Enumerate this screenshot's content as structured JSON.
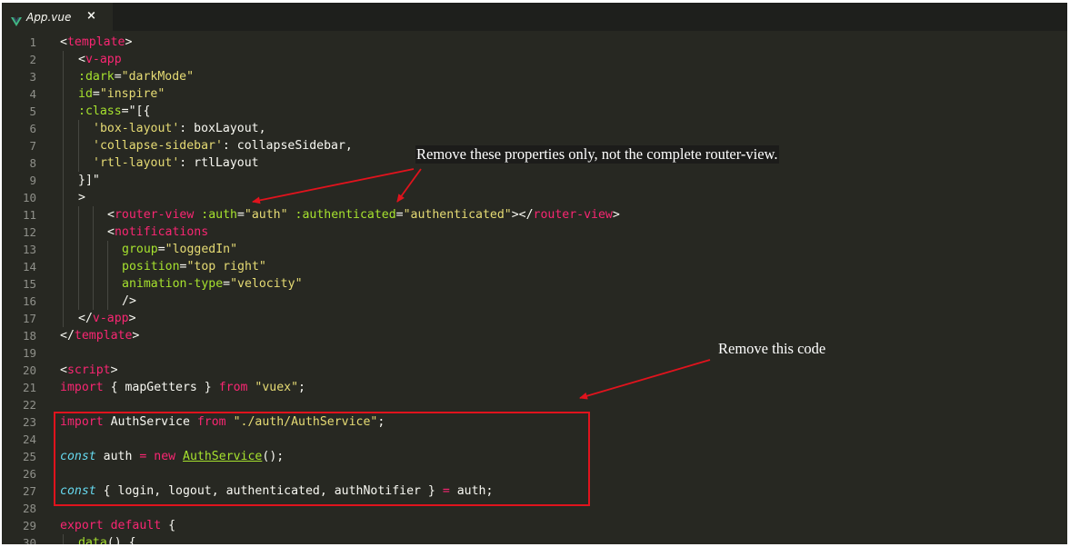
{
  "tab": {
    "title": "App.vue",
    "close": "×",
    "icon": "vue-icon"
  },
  "annotations": {
    "note1": "Remove these properties only, not the complete router-view.",
    "note2": "Remove this code",
    "arrow_color": "#e0131d"
  },
  "colors": {
    "background": "#272822",
    "tag": "#f92672",
    "attribute": "#a6e22e",
    "string": "#e6db74",
    "storage": "#66d9ef",
    "text": "#f8f8f2",
    "line_number": "#8f908a"
  },
  "lines": [
    {
      "n": "1",
      "indent": 0,
      "tokens": [
        [
          "plain",
          "<"
        ],
        [
          "tag",
          "template"
        ],
        [
          "plain",
          ">"
        ]
      ]
    },
    {
      "n": "2",
      "indent": 1,
      "tokens": [
        [
          "plain",
          "<"
        ],
        [
          "tag",
          "v-app"
        ]
      ]
    },
    {
      "n": "3",
      "indent": 1,
      "tokens": [
        [
          "attr",
          ":dark"
        ],
        [
          "plain",
          "="
        ],
        [
          "str",
          "\"darkMode\""
        ]
      ]
    },
    {
      "n": "4",
      "indent": 1,
      "tokens": [
        [
          "attr",
          "id"
        ],
        [
          "plain",
          "="
        ],
        [
          "str",
          "\"inspire\""
        ]
      ]
    },
    {
      "n": "5",
      "indent": 1,
      "tokens": [
        [
          "attr",
          ":class"
        ],
        [
          "plain",
          "=\"[{"
        ]
      ]
    },
    {
      "n": "6",
      "indent": 2,
      "tokens": [
        [
          "str",
          "'box-layout'"
        ],
        [
          "plain",
          ": boxLayout,"
        ]
      ]
    },
    {
      "n": "7",
      "indent": 2,
      "tokens": [
        [
          "str",
          "'collapse-sidebar'"
        ],
        [
          "plain",
          ": collapseSidebar,"
        ]
      ]
    },
    {
      "n": "8",
      "indent": 2,
      "tokens": [
        [
          "str",
          "'rtl-layout'"
        ],
        [
          "plain",
          ": rtlLayout"
        ]
      ]
    },
    {
      "n": "9",
      "indent": 1,
      "tokens": [
        [
          "plain",
          "}]\""
        ]
      ]
    },
    {
      "n": "10",
      "indent": 1,
      "tokens": [
        [
          "plain",
          ">"
        ]
      ]
    },
    {
      "n": "11",
      "indent": 3,
      "tokens": [
        [
          "plain",
          "<"
        ],
        [
          "tag",
          "router-view"
        ],
        [
          "plain",
          " "
        ],
        [
          "attr",
          ":auth"
        ],
        [
          "plain",
          "="
        ],
        [
          "str",
          "\"auth\""
        ],
        [
          "plain",
          " "
        ],
        [
          "attr",
          ":authenticated"
        ],
        [
          "plain",
          "="
        ],
        [
          "str",
          "\"authenticated\""
        ],
        [
          "plain",
          "></"
        ],
        [
          "tag",
          "router-view"
        ],
        [
          "plain",
          ">"
        ]
      ]
    },
    {
      "n": "12",
      "indent": 3,
      "tokens": [
        [
          "plain",
          "<"
        ],
        [
          "tag",
          "notifications"
        ]
      ]
    },
    {
      "n": "13",
      "indent": 4,
      "tokens": [
        [
          "attr",
          "group"
        ],
        [
          "plain",
          "="
        ],
        [
          "str",
          "\"loggedIn\""
        ]
      ]
    },
    {
      "n": "14",
      "indent": 4,
      "tokens": [
        [
          "attr",
          "position"
        ],
        [
          "plain",
          "="
        ],
        [
          "str",
          "\"top right\""
        ]
      ]
    },
    {
      "n": "15",
      "indent": 4,
      "tokens": [
        [
          "attr",
          "animation-type"
        ],
        [
          "plain",
          "="
        ],
        [
          "str",
          "\"velocity\""
        ]
      ]
    },
    {
      "n": "16",
      "indent": 4,
      "tokens": [
        [
          "plain",
          "/>"
        ]
      ]
    },
    {
      "n": "17",
      "indent": 1,
      "tokens": [
        [
          "plain",
          "</"
        ],
        [
          "tag",
          "v-app"
        ],
        [
          "plain",
          ">"
        ]
      ]
    },
    {
      "n": "18",
      "indent": 0,
      "tokens": [
        [
          "plain",
          "</"
        ],
        [
          "tag",
          "template"
        ],
        [
          "plain",
          ">"
        ]
      ]
    },
    {
      "n": "19",
      "indent": 0,
      "tokens": []
    },
    {
      "n": "20",
      "indent": 0,
      "tokens": [
        [
          "plain",
          "<"
        ],
        [
          "tag",
          "script"
        ],
        [
          "plain",
          ">"
        ]
      ]
    },
    {
      "n": "21",
      "indent": 0,
      "tokens": [
        [
          "kw",
          "import"
        ],
        [
          "plain",
          " { mapGetters } "
        ],
        [
          "kw",
          "from"
        ],
        [
          "plain",
          " "
        ],
        [
          "str",
          "\"vuex\""
        ],
        [
          "plain",
          ";"
        ]
      ]
    },
    {
      "n": "22",
      "indent": 0,
      "tokens": []
    },
    {
      "n": "23",
      "indent": 0,
      "tokens": [
        [
          "kw",
          "import"
        ],
        [
          "plain",
          " AuthService "
        ],
        [
          "kw",
          "from"
        ],
        [
          "plain",
          " "
        ],
        [
          "str",
          "\"./auth/AuthService\""
        ],
        [
          "plain",
          ";"
        ]
      ]
    },
    {
      "n": "24",
      "indent": 0,
      "tokens": []
    },
    {
      "n": "25",
      "indent": 0,
      "tokens": [
        [
          "storage",
          "const"
        ],
        [
          "plain",
          " auth "
        ],
        [
          "kw",
          "="
        ],
        [
          "plain",
          " "
        ],
        [
          "kw",
          "new"
        ],
        [
          "plain",
          " "
        ],
        [
          "cls",
          "AuthService"
        ],
        [
          "plain",
          "();"
        ]
      ]
    },
    {
      "n": "26",
      "indent": 0,
      "tokens": []
    },
    {
      "n": "27",
      "indent": 0,
      "tokens": [
        [
          "storage",
          "const"
        ],
        [
          "plain",
          " { login, logout, authenticated, authNotifier } "
        ],
        [
          "kw",
          "="
        ],
        [
          "plain",
          " auth;"
        ]
      ]
    },
    {
      "n": "28",
      "indent": 0,
      "tokens": []
    },
    {
      "n": "29",
      "indent": 0,
      "tokens": [
        [
          "kw",
          "export"
        ],
        [
          "plain",
          " "
        ],
        [
          "kw",
          "default"
        ],
        [
          "plain",
          " {"
        ]
      ]
    },
    {
      "n": "30",
      "indent": 1,
      "tokens": [
        [
          "fn",
          "data"
        ],
        [
          "plain",
          "() {"
        ]
      ]
    }
  ]
}
